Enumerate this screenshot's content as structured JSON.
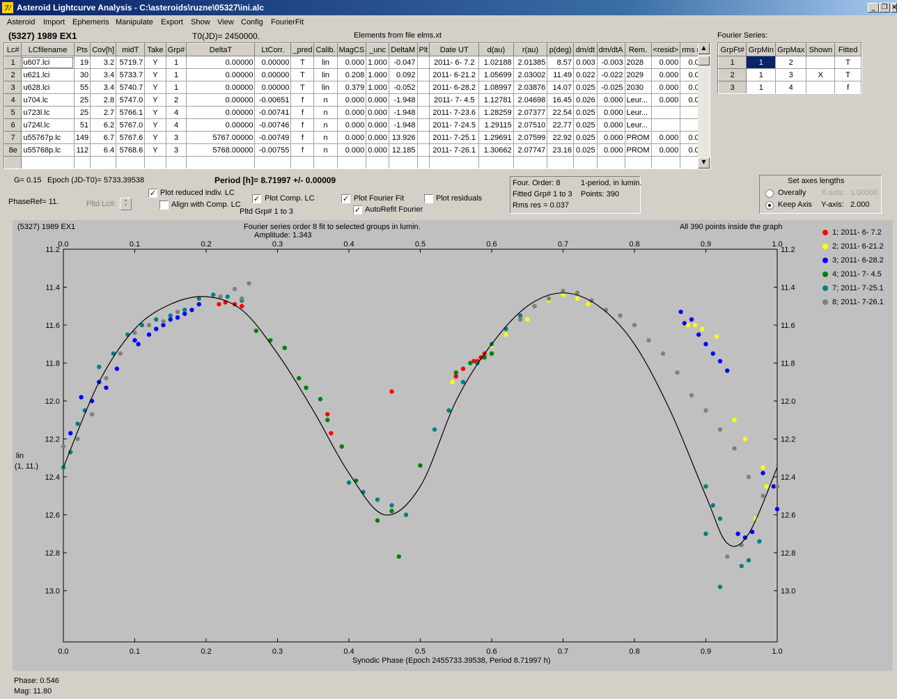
{
  "window": {
    "title": "Asteroid Lightcurve Analysis - C:\\asteroids\\ruzne\\05327\\ini.alc",
    "icon": "app-icon"
  },
  "menu": [
    "Asteroid",
    "Import",
    "Ephemeris",
    "Manipulate",
    "Export",
    "Show",
    "View",
    "Config",
    "FourierFit"
  ],
  "header": {
    "object": "(5327) 1989 EX1",
    "t0": "T0(JD)= 2450000.",
    "elements": "Elements from file elms.xt",
    "fourier_title": "Fourier Series:"
  },
  "lc_table": {
    "columns": [
      "Lc#",
      "LCfilename",
      "Pts",
      "Cov[h]",
      "midT",
      "Take",
      "Grp#",
      "DeltaT",
      "LtCorr.",
      "_pred",
      "Calib.",
      "MagCS",
      "_unc",
      "DeltaM",
      "Plt",
      "Date UT",
      "d(au)",
      "r(au)",
      "p(deg)",
      "dm/dt",
      "dm/dtA",
      "Rem.",
      "<resid>",
      "rms res"
    ],
    "rows": [
      [
        "1",
        "u607.lci",
        "19",
        "3.2",
        "5719.7",
        "Y",
        "1",
        "0.00000",
        "0.00000",
        "T",
        "lin",
        "0.000",
        "1.000",
        "-0.047",
        "",
        "2011- 6- 7.2",
        "1.02188",
        "2.01385",
        "8.57",
        "0.003",
        "-0.003",
        "2028",
        "0.000",
        "0.033"
      ],
      [
        "2",
        "u621.lci",
        "30",
        "3.4",
        "5733.7",
        "Y",
        "1",
        "0.00000",
        "0.00000",
        "T",
        "lin",
        "0.208",
        "1.000",
        "0.092",
        "",
        "2011- 6-21.2",
        "1.05699",
        "2.03002",
        "11.49",
        "0.022",
        "-0.022",
        "2029",
        "0.000",
        "0.027"
      ],
      [
        "3",
        "u628.lci",
        "55",
        "3.4",
        "5740.7",
        "Y",
        "1",
        "0.00000",
        "0.00000",
        "T",
        "lin",
        "0.379",
        "1.000",
        "-0.052",
        "",
        "2011- 6-28.2",
        "1.08997",
        "2.03876",
        "14.07",
        "0.025",
        "-0.025",
        "2030",
        "0.000",
        "0.042"
      ],
      [
        "4",
        "u704.lc",
        "25",
        "2.8",
        "5747.0",
        "Y",
        "2",
        "0.00000",
        "-0.00651",
        "f",
        "n",
        "0.000",
        "0.000",
        "-1.948",
        "",
        "2011- 7- 4.5",
        "1.12781",
        "2.04698",
        "16.45",
        "0.026",
        "0.000",
        "Leur...",
        "0.000",
        "0.040"
      ],
      [
        "5",
        "u723l.lc",
        "25",
        "2.7",
        "5766.1",
        "Y",
        "4",
        "0.00000",
        "-0.00741",
        "f",
        "n",
        "0.000",
        "0.000",
        "-1.948",
        "",
        "2011- 7-23.6",
        "1.28259",
        "2.07377",
        "22.54",
        "0.025",
        "0.000",
        "Leur...",
        "",
        ""
      ],
      [
        "6",
        "u724l.lc",
        "51",
        "6.2",
        "5767.0",
        "Y",
        "4",
        "0.00000",
        "-0.00746",
        "f",
        "n",
        "0.000",
        "0.000",
        "-1.948",
        "",
        "2011- 7-24.5",
        "1.29115",
        "2.07510",
        "22.77",
        "0.025",
        "0.000",
        "Leur...",
        "",
        ""
      ],
      [
        "7",
        "u55767p.lc",
        "149",
        "6.7",
        "5767.6",
        "Y",
        "3",
        "5767.00000",
        "-0.00749",
        "f",
        "n",
        "0.000",
        "0.000",
        "13.926",
        "",
        "2011- 7-25.1",
        "1.29691",
        "2.07599",
        "22.92",
        "0.025",
        "0.000",
        "PROM",
        "0.000",
        "0.035"
      ],
      [
        "8e",
        "u55768p.lc",
        "112",
        "6.4",
        "5768.6",
        "Y",
        "3",
        "5768.00000",
        "-0.00755",
        "f",
        "n",
        "0.000",
        "0.000",
        "12.185",
        "",
        "2011- 7-26.1",
        "1.30662",
        "2.07747",
        "23.16",
        "0.025",
        "0.000",
        "PROM",
        "0.000",
        "0.035"
      ]
    ]
  },
  "fourier_table": {
    "columns": [
      "GrpFt#",
      "GrpMin",
      "GrpMax",
      "Shown",
      "Fitted"
    ],
    "rows": [
      [
        "1",
        "1",
        "2",
        "",
        "T"
      ],
      [
        "2",
        "1",
        "3",
        "X",
        "T"
      ],
      [
        "3",
        "1",
        "4",
        "",
        "f"
      ]
    ]
  },
  "info": {
    "g": "G= 0.15",
    "epoch": "Epoch (JD-T0)= 5733.39538",
    "period": "Period [h]= 8.71997 +/- 0.00009",
    "phaseref": "PhaseRef= 11.",
    "pltd_lc": "Pltd Lc#:",
    "plot_reduced": "Plot reduced indiv. LC",
    "align_comp": "Align with Comp. LC",
    "plot_comp": "Plot Comp. LC",
    "pltd_grp": "Pltd Grp#  1   to   3",
    "plot_fourier": "Plot Fourier Fit",
    "autorefit": "AutoRefit Fourier",
    "plot_residuals": "Plot residuals",
    "four_order": "Four. Order:  8",
    "one_period": "1-period, in lumin.",
    "fitted_grp": "Fitted Grp# 1 to 3",
    "points": "Points: 390",
    "rms": "Rms res     = 0.037",
    "axes_title": "Set axes lengths",
    "overally": "Overally",
    "keep_axis": "Keep Axis",
    "xaxis_lbl": "X-axis:",
    "xaxis_val": "1.00000",
    "yaxis_lbl": "Y-axis:",
    "yaxis_val": "2.000"
  },
  "checks": {
    "plot_reduced": true,
    "align_comp": false,
    "plot_comp": true,
    "plot_fourier": true,
    "autorefit": true,
    "plot_residuals": false
  },
  "plot": {
    "name": "(5327) 1989 EX1",
    "subtitle1": "Fourier series order 8 fit to selected groups in lumin.",
    "subtitle2": "Amplitude: 1.343",
    "inside": "All 390 points inside the graph",
    "ylabel1": "lin",
    "ylabel2": "(1, 11.)",
    "xlabel": "Synodic Phase (Epoch 2455733.39538, Period 8.71997 h)",
    "legend": [
      {
        "label": "1; 2011- 6- 7.2",
        "color": "#ff0000"
      },
      {
        "label": "2; 2011- 6-21.2",
        "color": "#ffff00"
      },
      {
        "label": "3; 2011- 6-28.2",
        "color": "#0000ff"
      },
      {
        "label": "4; 2011- 7- 4.5",
        "color": "#008000"
      },
      {
        "label": "7; 2011- 7-25.1",
        "color": "#008080"
      },
      {
        "label": "8; 2011- 7-26.1",
        "color": "#808080"
      }
    ]
  },
  "chart_data": {
    "type": "scatter",
    "xlim": [
      0,
      1
    ],
    "ylim": [
      11.2,
      13.2
    ],
    "y_inverted": true,
    "xticks": [
      "0.0",
      "0.1",
      "0.2",
      "0.3",
      "0.4",
      "0.5",
      "0.6",
      "0.7",
      "0.8",
      "0.9",
      "1.0"
    ],
    "yticks": [
      "11.2",
      "11.4",
      "11.6",
      "11.8",
      "12.0",
      "12.2",
      "12.4",
      "12.6",
      "12.8",
      "13.0"
    ],
    "fit_curve": {
      "x": [
        0.0,
        0.05,
        0.1,
        0.15,
        0.2,
        0.25,
        0.3,
        0.35,
        0.4,
        0.45,
        0.5,
        0.55,
        0.6,
        0.65,
        0.7,
        0.75,
        0.8,
        0.85,
        0.9,
        0.93,
        0.96,
        1.0
      ],
      "y": [
        12.35,
        11.9,
        11.62,
        11.49,
        11.45,
        11.52,
        11.75,
        12.05,
        12.38,
        12.6,
        12.45,
        12.0,
        11.7,
        11.5,
        11.43,
        11.5,
        11.7,
        12.05,
        12.5,
        12.75,
        12.7,
        12.35
      ]
    },
    "series": [
      {
        "name": "1; 2011- 6- 7.2",
        "color": "#ff0000",
        "x": [
          0.218,
          0.227,
          0.24,
          0.25,
          0.46,
          0.37,
          0.375,
          0.55,
          0.56,
          0.575,
          0.58,
          0.585,
          0.59
        ],
        "y": [
          11.49,
          11.48,
          11.49,
          11.5,
          11.95,
          12.07,
          12.17,
          11.87,
          11.83,
          11.79,
          11.79,
          11.77,
          11.75
        ]
      },
      {
        "name": "2; 2011- 6-21.2",
        "color": "#ffff00",
        "x": [
          0.545,
          0.6,
          0.62,
          0.65,
          0.68,
          0.7,
          0.72,
          0.735,
          0.875,
          0.895,
          0.915,
          0.94,
          0.955,
          0.98,
          0.985,
          0.97,
          0.885
        ],
        "y": [
          11.9,
          11.71,
          11.65,
          11.57,
          11.47,
          11.44,
          11.46,
          11.49,
          11.6,
          11.62,
          11.66,
          12.1,
          12.2,
          12.35,
          12.45,
          12.62,
          11.6
        ]
      },
      {
        "name": "3; 2011- 6-28.2",
        "color": "#0000ff",
        "x": [
          0.01,
          0.025,
          0.04,
          0.05,
          0.06,
          0.075,
          0.1,
          0.105,
          0.12,
          0.13,
          0.14,
          0.15,
          0.16,
          0.17,
          0.18,
          0.19,
          0.865,
          0.87,
          0.88,
          0.89,
          0.9,
          0.91,
          0.92,
          0.93,
          0.98,
          0.995,
          1.0,
          1.01,
          1.02,
          0.945,
          0.955,
          0.965
        ],
        "y": [
          12.17,
          11.98,
          12.0,
          11.9,
          11.93,
          11.83,
          11.68,
          11.7,
          11.65,
          11.62,
          11.6,
          11.57,
          11.56,
          11.54,
          11.52,
          11.49,
          11.53,
          11.59,
          11.57,
          11.65,
          11.7,
          11.75,
          11.79,
          11.84,
          12.38,
          12.45,
          12.57,
          12.52,
          12.5,
          12.7,
          12.72,
          12.69
        ]
      },
      {
        "name": "4; 2011- 7- 4.5",
        "color": "#008000",
        "x": [
          0.27,
          0.29,
          0.31,
          0.33,
          0.34,
          0.36,
          0.37,
          0.39,
          0.41,
          0.44,
          0.46,
          0.47,
          0.5,
          0.55,
          0.57,
          0.59,
          0.6
        ],
        "y": [
          11.63,
          11.68,
          11.72,
          11.88,
          11.93,
          11.99,
          12.1,
          12.24,
          12.42,
          12.63,
          12.58,
          12.82,
          12.34,
          11.85,
          11.8,
          11.77,
          11.75
        ]
      },
      {
        "name": "7; 2011- 7-25.1",
        "color": "#008080",
        "x": [
          0.0,
          0.01,
          0.02,
          0.03,
          0.05,
          0.07,
          0.09,
          0.11,
          0.13,
          0.15,
          0.17,
          0.19,
          0.21,
          0.23,
          0.25,
          0.4,
          0.42,
          0.44,
          0.46,
          0.48,
          0.52,
          0.54,
          0.56,
          0.58,
          0.6,
          0.62,
          0.64,
          0.66,
          0.9,
          0.91,
          0.92,
          0.95,
          0.96,
          0.975,
          0.9,
          0.92
        ],
        "y": [
          12.35,
          12.27,
          12.12,
          12.05,
          11.82,
          11.75,
          11.65,
          11.6,
          11.57,
          11.55,
          11.52,
          11.46,
          11.44,
          11.45,
          11.47,
          12.43,
          12.48,
          12.52,
          12.55,
          12.6,
          12.15,
          12.05,
          11.9,
          11.8,
          11.7,
          11.62,
          11.55,
          11.5,
          12.45,
          12.55,
          12.62,
          12.87,
          12.84,
          12.74,
          12.7,
          12.98
        ]
      },
      {
        "name": "8; 2011- 7-26.1",
        "color": "#808080",
        "x": [
          0.0,
          0.02,
          0.04,
          0.06,
          0.08,
          0.1,
          0.12,
          0.14,
          0.16,
          0.22,
          0.24,
          0.26,
          0.25,
          0.64,
          0.66,
          0.68,
          0.7,
          0.72,
          0.74,
          0.76,
          0.78,
          0.8,
          0.82,
          0.84,
          0.86,
          0.88,
          0.9,
          0.92,
          0.94,
          0.96,
          0.98,
          1.0,
          1.02,
          0.93,
          0.95
        ],
        "y": [
          12.24,
          12.2,
          12.07,
          11.88,
          11.75,
          11.64,
          11.6,
          11.58,
          11.53,
          11.45,
          11.41,
          11.38,
          11.46,
          11.57,
          11.5,
          11.46,
          11.42,
          11.43,
          11.47,
          11.52,
          11.55,
          11.6,
          11.68,
          11.75,
          11.85,
          11.97,
          12.05,
          12.15,
          12.25,
          12.4,
          12.5,
          12.45,
          12.36,
          12.82,
          12.76
        ]
      }
    ]
  },
  "status": {
    "phase": "Phase:  0.546",
    "mag": "Mag:    11.80"
  }
}
